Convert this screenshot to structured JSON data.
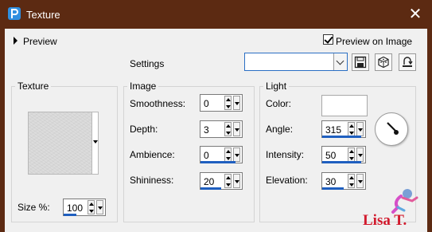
{
  "window": {
    "title": "Texture",
    "close_glyph": "✕",
    "frame_color": "#5c2a12"
  },
  "preview": {
    "label": "Preview",
    "preview_on_image_label": "Preview on Image",
    "preview_on_image_checked": true
  },
  "settings": {
    "label": "Settings",
    "value": ""
  },
  "toolbar_icons": [
    "save-preset-icon",
    "randomize-icon",
    "reset-icon"
  ],
  "texture_group": {
    "title": "Texture",
    "size_label": "Size %:",
    "size_value": "100",
    "size_fill": 0.3
  },
  "image_group": {
    "title": "Image",
    "smoothness_label": "Smoothness:",
    "smoothness_value": "0",
    "smoothness_fill": 0.0,
    "depth_label": "Depth:",
    "depth_value": "3",
    "depth_fill": 0.0,
    "ambience_label": "Ambience:",
    "ambience_value": "0",
    "ambience_fill": 0.85,
    "shininess_label": "Shininess:",
    "shininess_value": "20",
    "shininess_fill": 0.5
  },
  "light_group": {
    "title": "Light",
    "color_label": "Color:",
    "color_value": "#ffffff",
    "angle_label": "Angle:",
    "angle_value": "315",
    "angle_fill": 0.9,
    "intensity_label": "Intensity:",
    "intensity_value": "50",
    "intensity_fill": 0.9,
    "elevation_label": "Elevation:",
    "elevation_value": "30",
    "elevation_fill": 0.5
  },
  "watermark": {
    "text": "Lisa T."
  }
}
